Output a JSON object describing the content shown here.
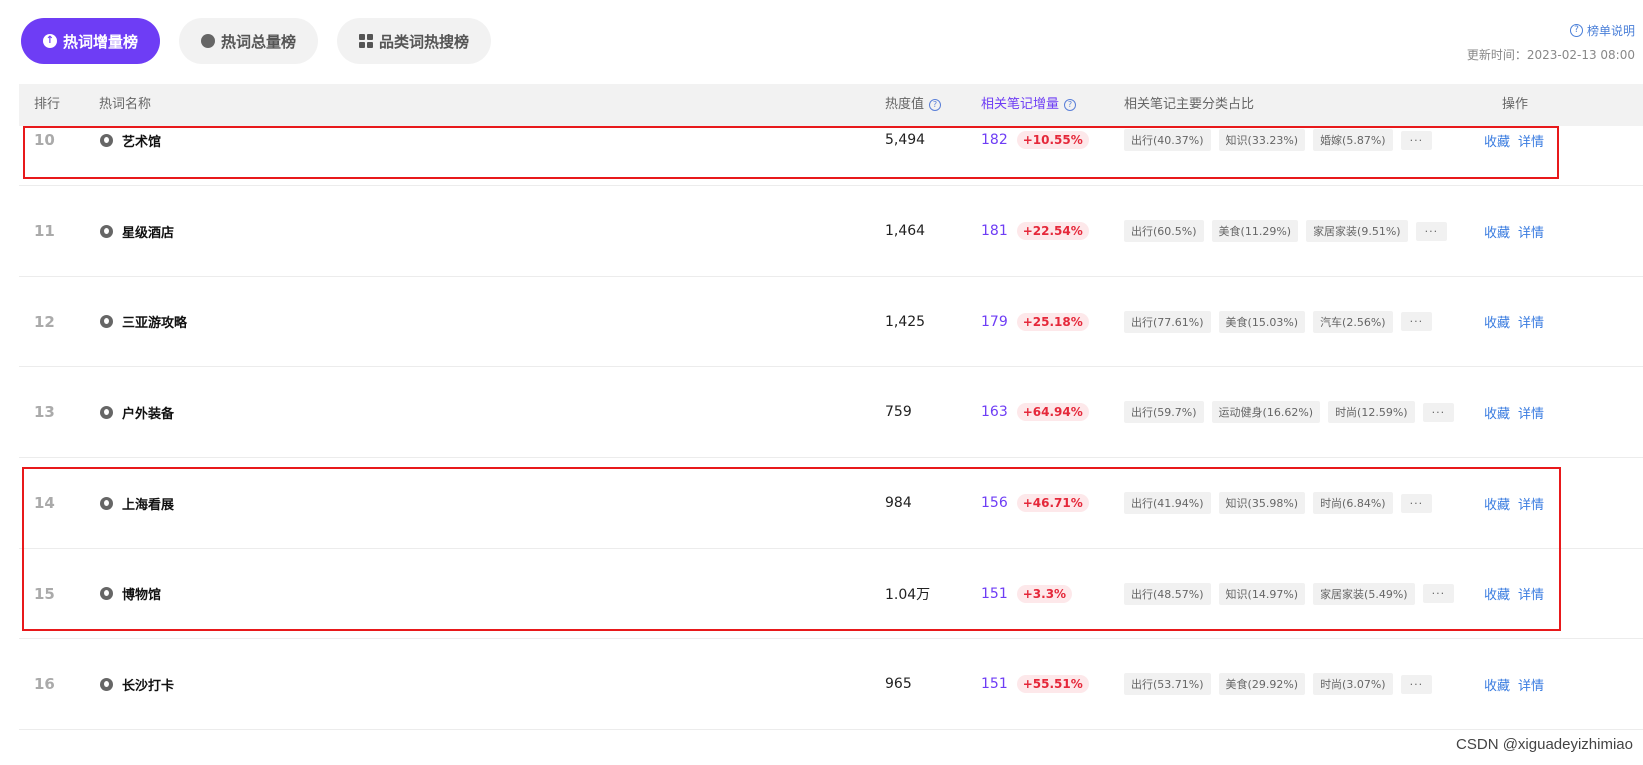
{
  "tabs": [
    {
      "label": "热词增量榜",
      "active": true,
      "icon": "arrow-up-circle-icon"
    },
    {
      "label": "热词总量榜",
      "active": false,
      "icon": "fire-icon"
    },
    {
      "label": "品类词热搜榜",
      "active": false,
      "icon": "grid-icon"
    }
  ],
  "rank_help": {
    "label": "榜单说明",
    "icon": "help-icon"
  },
  "update_time": "更新时间：2023-02-13 08:00",
  "table": {
    "headers": {
      "rank": "排行",
      "keyword": "热词名称",
      "heat": "热度值",
      "increment": "相关笔记增量",
      "categories": "相关笔记主要分类占比",
      "ops": "操作"
    },
    "rows": [
      {
        "rank": "10",
        "keyword": "艺术馆",
        "heat": "5,494",
        "increment": "182",
        "pct": "+10.55%",
        "cats": [
          "出行(40.37%)",
          "知识(33.23%)",
          "婚嫁(5.87%)"
        ]
      },
      {
        "rank": "11",
        "keyword": "星级酒店",
        "heat": "1,464",
        "increment": "181",
        "pct": "+22.54%",
        "cats": [
          "出行(60.5%)",
          "美食(11.29%)",
          "家居家装(9.51%)"
        ]
      },
      {
        "rank": "12",
        "keyword": "三亚游攻略",
        "heat": "1,425",
        "increment": "179",
        "pct": "+25.18%",
        "cats": [
          "出行(77.61%)",
          "美食(15.03%)",
          "汽车(2.56%)"
        ]
      },
      {
        "rank": "13",
        "keyword": "户外装备",
        "heat": "759",
        "increment": "163",
        "pct": "+64.94%",
        "cats": [
          "出行(59.7%)",
          "运动健身(16.62%)",
          "时尚(12.59%)"
        ]
      },
      {
        "rank": "14",
        "keyword": "上海看展",
        "heat": "984",
        "increment": "156",
        "pct": "+46.71%",
        "cats": [
          "出行(41.94%)",
          "知识(35.98%)",
          "时尚(6.84%)"
        ]
      },
      {
        "rank": "15",
        "keyword": "博物馆",
        "heat": "1.04万",
        "increment": "151",
        "pct": "+3.3%",
        "cats": [
          "出行(48.57%)",
          "知识(14.97%)",
          "家居家装(5.49%)"
        ]
      },
      {
        "rank": "16",
        "keyword": "长沙打卡",
        "heat": "965",
        "increment": "151",
        "pct": "+55.51%",
        "cats": [
          "出行(53.71%)",
          "美食(29.92%)",
          "时尚(3.07%)"
        ]
      }
    ],
    "more_label": "···",
    "op_collect": "收藏",
    "op_detail": "详情"
  },
  "watermark": "CSDN @xiguadeyizhimiao",
  "colors": {
    "accent": "#6e3df5",
    "highlight": "#e8191b",
    "link": "#3a7ce0",
    "pct_text": "#e5283a"
  }
}
